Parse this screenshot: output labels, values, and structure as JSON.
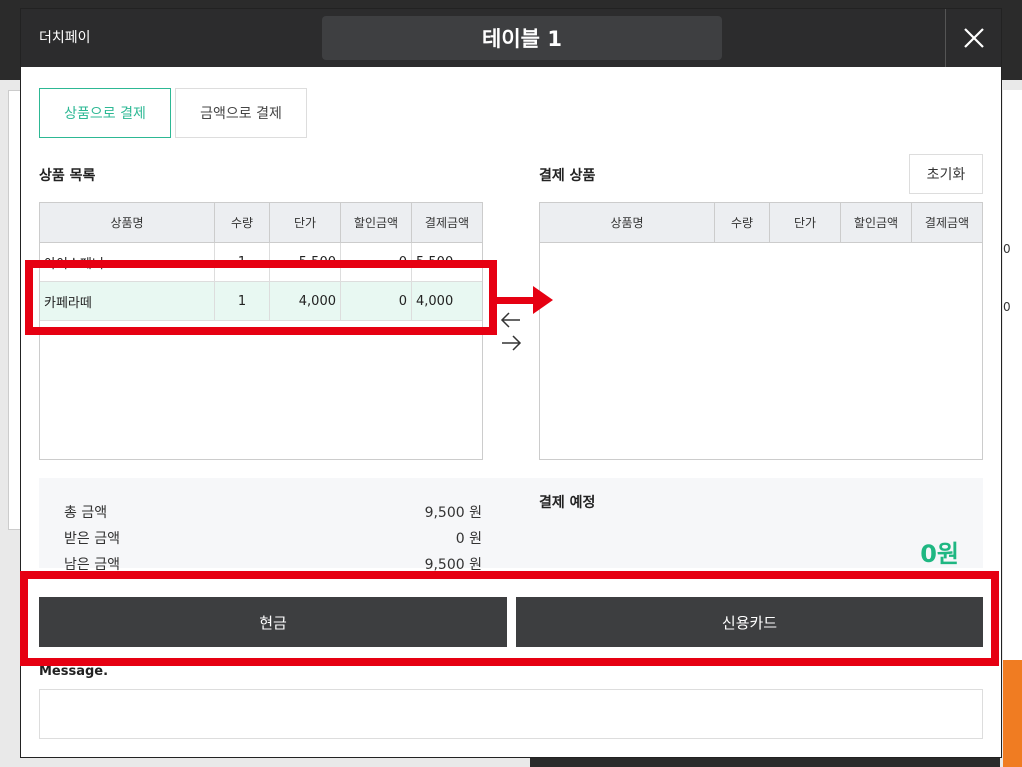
{
  "colors": {
    "accent": "#2db894",
    "header": "#2c2c2d",
    "highlight": "#e60012",
    "amount": "#1fb782",
    "button": "#3d3e40"
  },
  "header": {
    "brand": "더치페이",
    "title": "테이블 1"
  },
  "tabs": [
    {
      "label": "상품으로 결제",
      "active": true
    },
    {
      "label": "금액으로 결제",
      "active": false
    }
  ],
  "product_list": {
    "title": "상품 목록",
    "columns": [
      "상품명",
      "수량",
      "단가",
      "할인금액",
      "결제금액"
    ],
    "rows": [
      {
        "name": "아이스페너",
        "qty": "1",
        "price": "5,500",
        "discount": "0",
        "total": "5,500"
      },
      {
        "name": "카페라떼",
        "qty": "1",
        "price": "4,000",
        "discount": "0",
        "total": "4,000"
      }
    ]
  },
  "payment_list": {
    "title": "결제 상품",
    "reset_label": "초기화",
    "columns": [
      "상품명",
      "수량",
      "단가",
      "할인금액",
      "결제금액"
    ]
  },
  "summary": {
    "total_label": "총 금액",
    "total_value": "9,500 원",
    "received_label": "받은 금액",
    "received_value": "0 원",
    "remaining_label": "남은 금액",
    "remaining_value": "9,500 원",
    "scheduled_label": "결제 예정",
    "scheduled_value": "0원"
  },
  "buttons": {
    "cash": "현금",
    "card": "신용카드"
  },
  "message": {
    "label": "Message.",
    "placeholder": ""
  },
  "background": {
    "right_numbers": [
      "0",
      "0"
    ]
  }
}
